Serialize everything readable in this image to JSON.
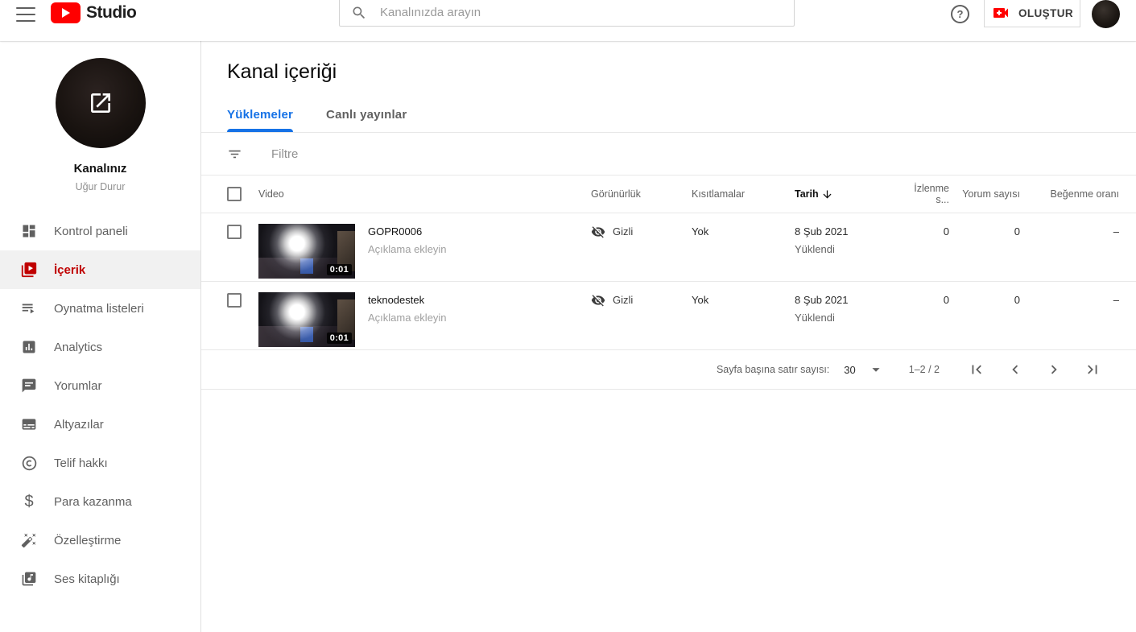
{
  "colors": {
    "brand_red": "#ff0000",
    "active_item_red": "#c00000",
    "tab_active_blue": "#1672e6"
  },
  "topbar": {
    "brand": "Studio",
    "search_placeholder": "Kanalınızda arayın",
    "help_glyph": "?",
    "create_label": "OLUŞTUR"
  },
  "sidebar": {
    "channel_label": "Kanalınız",
    "channel_name": "Uğur Durur",
    "items": [
      {
        "icon": "dashboard-icon",
        "label": "Kontrol paneli",
        "active": false
      },
      {
        "icon": "content-icon",
        "label": "İçerik",
        "active": true
      },
      {
        "icon": "playlists-icon",
        "label": "Oynatma listeleri",
        "active": false
      },
      {
        "icon": "analytics-icon",
        "label": "Analytics",
        "active": false
      },
      {
        "icon": "comments-icon",
        "label": "Yorumlar",
        "active": false
      },
      {
        "icon": "subtitles-icon",
        "label": "Altyazılar",
        "active": false
      },
      {
        "icon": "copyright-icon",
        "label": "Telif hakkı",
        "active": false
      },
      {
        "icon": "monetization-icon",
        "label": "Para kazanma",
        "active": false
      },
      {
        "icon": "customization-icon",
        "label": "Özelleştirme",
        "active": false
      },
      {
        "icon": "audio-library-icon",
        "label": "Ses kitaplığı",
        "active": false
      }
    ]
  },
  "main": {
    "title": "Kanal içeriği",
    "tabs": [
      {
        "label": "Yüklemeler",
        "active": true
      },
      {
        "label": "Canlı yayınlar",
        "active": false
      }
    ],
    "filter_label": "Filtre",
    "table": {
      "headers": {
        "video": "Video",
        "visibility": "Görünürlük",
        "restrictions": "Kısıtlamalar",
        "date": "Tarih",
        "views": "İzlenme s...",
        "comments": "Yorum sayısı",
        "likes": "Beğenme oranı"
      },
      "rows": [
        {
          "title": "GOPR0006",
          "subtitle": "Açıklama ekleyin",
          "duration": "0:01",
          "visibility": "Gizli",
          "restrictions": "Yok",
          "date": "8 Şub 2021",
          "date_sub": "Yüklendi",
          "views": "0",
          "comments": "0",
          "likes": "–"
        },
        {
          "title": "teknodestek",
          "subtitle": "Açıklama ekleyin",
          "duration": "0:01",
          "visibility": "Gizli",
          "restrictions": "Yok",
          "date": "8 Şub 2021",
          "date_sub": "Yüklendi",
          "views": "0",
          "comments": "0",
          "likes": "–"
        }
      ]
    },
    "pagination": {
      "rows_per_page_label": "Sayfa başına satır sayısı:",
      "rows_per_page_value": "30",
      "range_label": "1–2 / 2"
    }
  }
}
